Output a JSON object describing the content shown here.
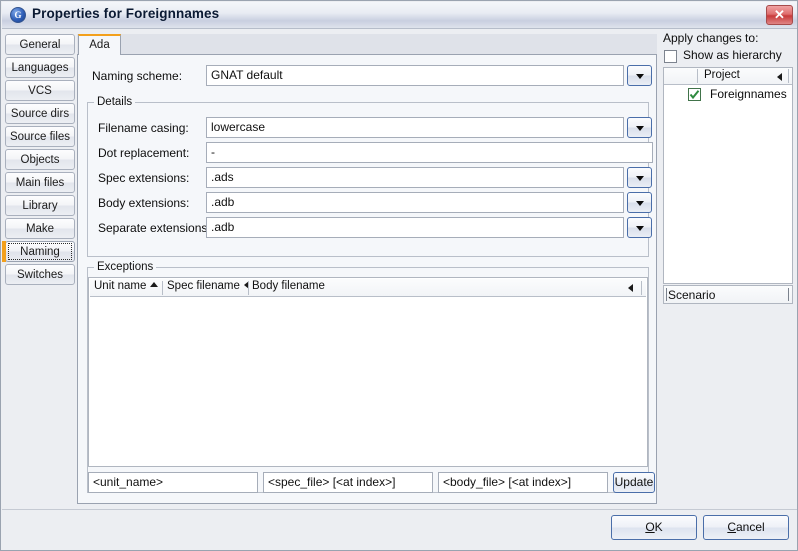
{
  "window": {
    "title": "Properties for Foreignnames",
    "icon": "app-globe-icon",
    "close_label": "✕"
  },
  "side_tabs": [
    {
      "label": "General",
      "selected": false
    },
    {
      "label": "Languages",
      "selected": false
    },
    {
      "label": "VCS",
      "selected": false
    },
    {
      "label": "Source dirs",
      "selected": false
    },
    {
      "label": "Source files",
      "selected": false
    },
    {
      "label": "Objects",
      "selected": false
    },
    {
      "label": "Main files",
      "selected": false
    },
    {
      "label": "Library",
      "selected": false
    },
    {
      "label": "Make",
      "selected": false
    },
    {
      "label": "Naming",
      "selected": true
    },
    {
      "label": "Switches",
      "selected": false
    }
  ],
  "tabs": [
    {
      "label": "Ada",
      "selected": true
    }
  ],
  "form": {
    "naming_scheme": {
      "label": "Naming scheme:",
      "value": "GNAT default",
      "has_dropdown": true
    },
    "details_group": "Details",
    "fields": [
      {
        "label": "Filename casing:",
        "value": "lowercase",
        "has_dropdown": true
      },
      {
        "label": "Dot replacement:",
        "value": "-",
        "has_dropdown": false
      },
      {
        "label": "Spec extensions:",
        "value": ".ads",
        "has_dropdown": true
      },
      {
        "label": "Body extensions:",
        "value": ".adb",
        "has_dropdown": true
      },
      {
        "label": "Separate extensions:",
        "value": ".adb",
        "has_dropdown": true
      }
    ]
  },
  "exceptions": {
    "group_label": "Exceptions",
    "columns": [
      {
        "label": "Unit name",
        "sort": "asc"
      },
      {
        "label": "Spec filename",
        "sort": "collapse"
      },
      {
        "label": "Body filename",
        "sort": "none"
      }
    ],
    "rows": [],
    "entry_row": {
      "unit_name": "<unit_name>",
      "spec_file": "<spec_file> [<at index>]",
      "body_file": "<body_file> [<at index>]",
      "update_label": "Update"
    }
  },
  "right_panel": {
    "apply_label": "Apply changes to:",
    "show_hierarchy": {
      "label": "Show as hierarchy",
      "checked": false
    },
    "tree": {
      "header": "Project",
      "items": [
        {
          "label": "Foreignnames",
          "checked": true
        }
      ]
    },
    "scenario_label": "Scenario"
  },
  "footer": {
    "ok": {
      "pre": "",
      "mnemonic": "O",
      "post": "K"
    },
    "cancel": {
      "pre": "",
      "mnemonic": "C",
      "post": "ancel"
    }
  },
  "colors": {
    "accent_orange": "#f3a01c",
    "close_red": "#c83a3a",
    "check_green": "#2f8a3f",
    "panel_bg": "#f5f7fa",
    "window_bg": "#eceef2"
  }
}
